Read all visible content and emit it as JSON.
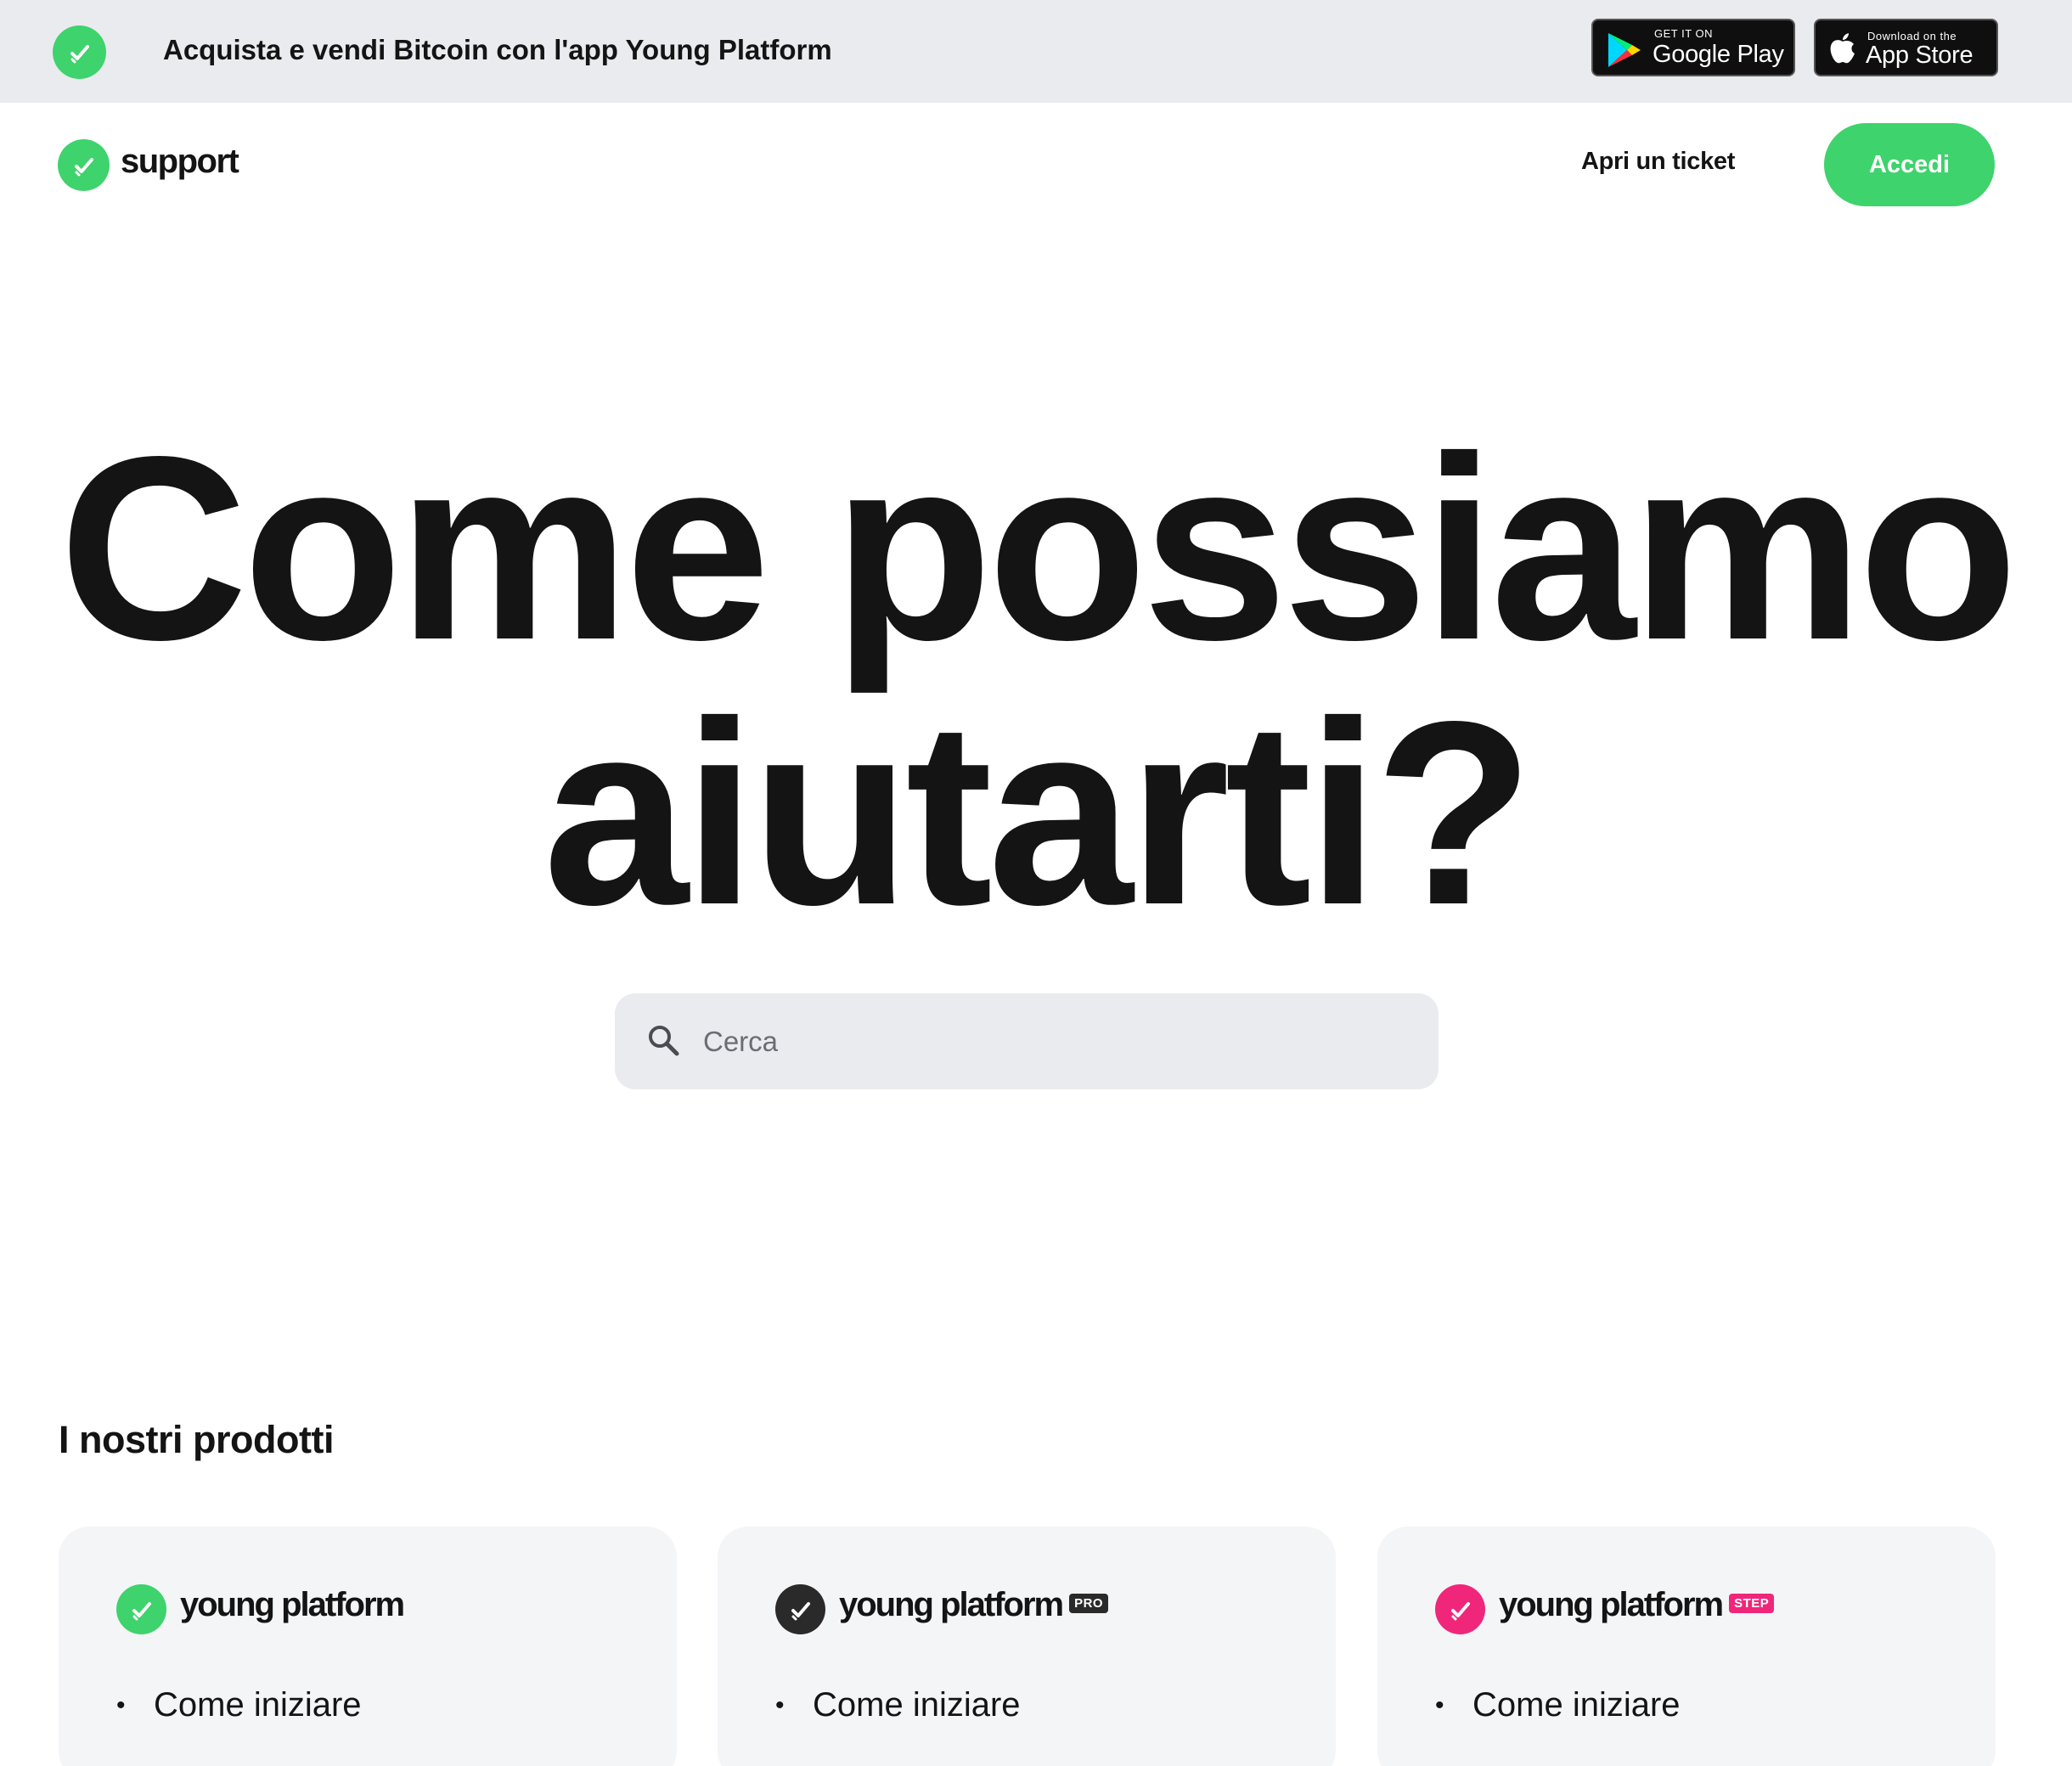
{
  "promo": {
    "text": "Acquista e vendi Bitcoin con l'app Young Platform",
    "google_play": {
      "small": "GET IT ON",
      "big": "Google Play"
    },
    "app_store": {
      "small": "Download on the",
      "big": "App Store"
    }
  },
  "header": {
    "brand": "support",
    "ticket_link": "Apri un ticket",
    "login_button": "Accedi"
  },
  "hero": {
    "title": "Come possiamo aiutarti?",
    "search_placeholder": "Cerca"
  },
  "products": {
    "title": "I nostri prodotti",
    "cards": [
      {
        "name": "young platform",
        "badge": "",
        "logo_color": "#3ed36c",
        "items": [
          "Come iniziare"
        ]
      },
      {
        "name": "young platform",
        "badge": "PRO",
        "badge_color": "#2a2a2a",
        "logo_color": "#2a2a2a",
        "items": [
          "Come iniziare"
        ]
      },
      {
        "name": "young platform",
        "badge": "STEP",
        "badge_color": "#f0267a",
        "logo_color": "#f0267a",
        "items": [
          "Come iniziare"
        ]
      }
    ]
  },
  "colors": {
    "accent": "#3ed36c",
    "banner_bg": "#eaebef",
    "card_bg": "#f4f5f7",
    "step": "#f0267a"
  }
}
